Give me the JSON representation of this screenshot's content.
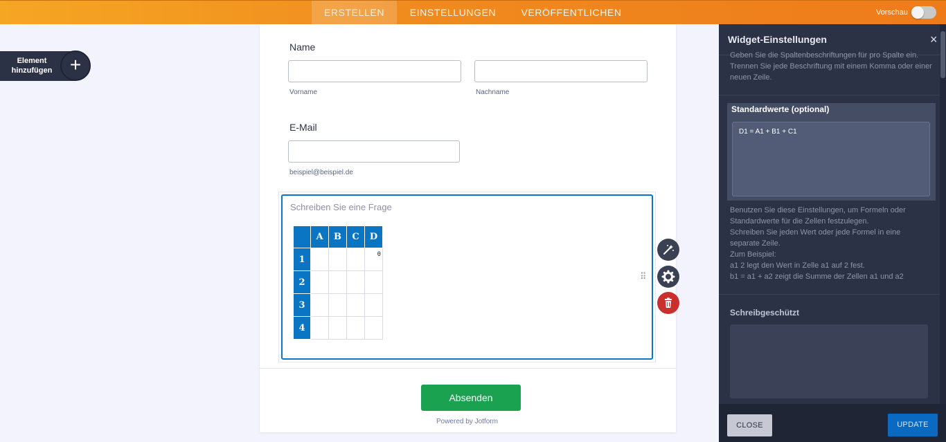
{
  "topbar": {
    "tabs": [
      {
        "label": "ERSTELLEN",
        "active": true
      },
      {
        "label": "EINSTELLUNGEN",
        "active": false
      },
      {
        "label": "VERÖFFENTLICHEN",
        "active": false
      }
    ],
    "preview_label": "Vorschau",
    "preview_toggle_on": false
  },
  "sidebar_left": {
    "add_element_label": "Element hinzufügen",
    "plus_icon": "+"
  },
  "form": {
    "name": {
      "label": "Name",
      "first_sublabel": "Vorname",
      "last_sublabel": "Nachname",
      "first_value": "",
      "last_value": ""
    },
    "email": {
      "label": "E-Mail",
      "sublabel": "beispiel@beispiel.de",
      "value": ""
    },
    "question": {
      "placeholder": "Schreiben Sie eine Frage",
      "columns": [
        "A",
        "B",
        "C",
        "D"
      ],
      "rows": [
        "1",
        "2",
        "3",
        "4"
      ],
      "cells": [
        [
          "",
          "",
          "",
          "0"
        ],
        [
          "",
          "",
          "",
          ""
        ],
        [
          "",
          "",
          "",
          ""
        ],
        [
          "",
          "",
          "",
          ""
        ]
      ]
    },
    "submit_label": "Absenden",
    "powered_by": "Powered by Jotform"
  },
  "side_tools": {
    "drag_icon": "⠿",
    "wand_icon": "magic-wand-icon",
    "gear_icon": "gear-icon",
    "trash_icon": "trash-icon"
  },
  "panel": {
    "title": "Widget-Einstellungen",
    "close_icon": "×",
    "top_text": "Geben Sie die Spaltenbeschriftungen für pro Spalte ein. Trennen Sie jede Beschriftung mit einem Komma oder einer neuen Zeile.",
    "defaults_title": "Standardwerte (optional)",
    "defaults_value": "D1 = A1 + B1 + C1",
    "help_text": [
      "Benutzen Sie diese Einstellungen, um Formeln oder",
      "Standardwerte für die Zellen festzulegen.",
      "Schreiben Sie jeden Wert oder jede Formel in eine",
      "separate Zeile.",
      "Zum Beispiel:",
      "a1 2 legt den Wert in Zelle a1 auf 2 fest.",
      "b1 = a1 + a2 zeigt die Summe der Zellen a1 und a2"
    ],
    "readonly_title": "Schreibgeschützt",
    "readonly_value": "",
    "close_button": "CLOSE",
    "update_button": "UPDATE"
  },
  "colors": {
    "topbar": "#f08a1e",
    "panel": "#2b3245",
    "table_header": "#0a75c2",
    "submit": "#1aa251",
    "delete": "#c9302c",
    "update": "#0a6ac2"
  }
}
